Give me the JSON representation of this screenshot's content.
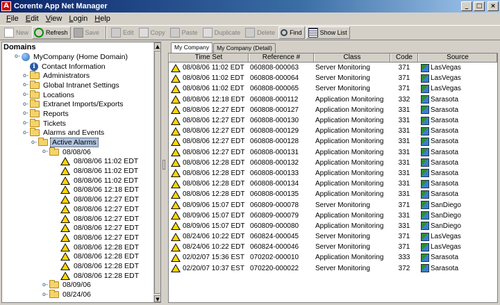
{
  "window": {
    "title": "Corente App Net Manager",
    "app_icon": "A"
  },
  "menu": [
    {
      "label": "File",
      "key": "F",
      "rest": "ile"
    },
    {
      "label": "Edit",
      "key": "E",
      "rest": "dit"
    },
    {
      "label": "View",
      "key": "V",
      "rest": "iew"
    },
    {
      "label": "Login",
      "key": "L",
      "rest": "ogin"
    },
    {
      "label": "Help",
      "key": "H",
      "rest": "elp"
    }
  ],
  "toolbar": {
    "new": "New",
    "refresh": "Refresh",
    "save": "Save",
    "edit": "Edit",
    "copy": "Copy",
    "paste": "Paste",
    "duplicate": "Duplicate",
    "delete": "Delete",
    "find": "Find",
    "show_list": "Show List"
  },
  "left": {
    "header": "Domains",
    "tree": [
      {
        "label": "MyCompany (Home Domain)",
        "icon": "globe",
        "level": 0,
        "exp": "minus"
      },
      {
        "label": "Contact Information",
        "icon": "info",
        "level": 1,
        "exp": "none"
      },
      {
        "label": "Administrators",
        "icon": "folder",
        "level": 1,
        "exp": "plus"
      },
      {
        "label": "Global Intranet Settings",
        "icon": "folder",
        "level": 1,
        "exp": "plus"
      },
      {
        "label": "Locations",
        "icon": "folder",
        "level": 1,
        "exp": "plus"
      },
      {
        "label": "Extranet Imports/Exports",
        "icon": "folder",
        "level": 1,
        "exp": "plus"
      },
      {
        "label": "Reports",
        "icon": "folder",
        "level": 1,
        "exp": "plus"
      },
      {
        "label": "Tickets",
        "icon": "folder",
        "level": 1,
        "exp": "plus"
      },
      {
        "label": "Alarms and Events",
        "icon": "folder",
        "level": 1,
        "exp": "minus"
      },
      {
        "label": "Active Alarms",
        "icon": "folder",
        "level": 2,
        "exp": "minus",
        "selected": true
      },
      {
        "label": "08/08/06",
        "icon": "folder",
        "level": 3,
        "exp": "minus"
      },
      {
        "label": "08/08/06 11:02 EDT",
        "icon": "warn",
        "level": 4,
        "exp": "none"
      },
      {
        "label": "08/08/06 11:02 EDT",
        "icon": "warn",
        "level": 4,
        "exp": "none"
      },
      {
        "label": "08/08/06 11:02 EDT",
        "icon": "warn",
        "level": 4,
        "exp": "none"
      },
      {
        "label": "08/08/06 12:18 EDT",
        "icon": "warn",
        "level": 4,
        "exp": "none"
      },
      {
        "label": "08/08/06 12:27 EDT",
        "icon": "warn",
        "level": 4,
        "exp": "none"
      },
      {
        "label": "08/08/06 12:27 EDT",
        "icon": "warn",
        "level": 4,
        "exp": "none"
      },
      {
        "label": "08/08/06 12:27 EDT",
        "icon": "warn",
        "level": 4,
        "exp": "none"
      },
      {
        "label": "08/08/06 12:27 EDT",
        "icon": "warn",
        "level": 4,
        "exp": "none"
      },
      {
        "label": "08/08/06 12:27 EDT",
        "icon": "warn",
        "level": 4,
        "exp": "none"
      },
      {
        "label": "08/08/06 12:28 EDT",
        "icon": "warn",
        "level": 4,
        "exp": "none"
      },
      {
        "label": "08/08/06 12:28 EDT",
        "icon": "warn",
        "level": 4,
        "exp": "none"
      },
      {
        "label": "08/08/06 12:28 EDT",
        "icon": "warn",
        "level": 4,
        "exp": "none"
      },
      {
        "label": "08/08/06 12:28 EDT",
        "icon": "warn",
        "level": 4,
        "exp": "none"
      },
      {
        "label": "08/09/06",
        "icon": "folder",
        "level": 3,
        "exp": "plus"
      },
      {
        "label": "08/24/06",
        "icon": "folder",
        "level": 3,
        "exp": "plus"
      }
    ]
  },
  "tabs": [
    "My Company",
    "My Company (Detail)"
  ],
  "table": {
    "columns": [
      "Time Set",
      "Reference #",
      "Class",
      "Code",
      "Source"
    ],
    "rows": [
      [
        "08/08/06 11:02 EDT",
        "060808-000063",
        "Server Monitoring",
        "371",
        "LasVegas"
      ],
      [
        "08/08/06 11:02 EDT",
        "060808-000064",
        "Server Monitoring",
        "371",
        "LasVegas"
      ],
      [
        "08/08/06 11:02 EDT",
        "060808-000065",
        "Server Monitoring",
        "371",
        "LasVegas"
      ],
      [
        "08/08/06 12:18 EDT",
        "060808-000112",
        "Application Monitoring",
        "332",
        "Sarasota"
      ],
      [
        "08/08/06 12:27 EDT",
        "060808-000127",
        "Application Monitoring",
        "331",
        "Sarasota"
      ],
      [
        "08/08/06 12:27 EDT",
        "060808-000130",
        "Application Monitoring",
        "331",
        "Sarasota"
      ],
      [
        "08/08/06 12:27 EDT",
        "060808-000129",
        "Application Monitoring",
        "331",
        "Sarasota"
      ],
      [
        "08/08/06 12:27 EDT",
        "060808-000128",
        "Application Monitoring",
        "331",
        "Sarasota"
      ],
      [
        "08/08/06 12:27 EDT",
        "060808-000131",
        "Application Monitoring",
        "331",
        "Sarasota"
      ],
      [
        "08/08/06 12:28 EDT",
        "060808-000132",
        "Application Monitoring",
        "331",
        "Sarasota"
      ],
      [
        "08/08/06 12:28 EDT",
        "060808-000133",
        "Application Monitoring",
        "331",
        "Sarasota"
      ],
      [
        "08/08/06 12:28 EDT",
        "060808-000134",
        "Application Monitoring",
        "331",
        "Sarasota"
      ],
      [
        "08/08/06 12:28 EDT",
        "060808-000135",
        "Application Monitoring",
        "331",
        "Sarasota"
      ],
      [
        "08/09/06 15:07 EDT",
        "060809-000078",
        "Server Monitoring",
        "371",
        "SanDiego"
      ],
      [
        "08/09/06 15:07 EDT",
        "060809-000079",
        "Application Monitoring",
        "331",
        "SanDiego"
      ],
      [
        "08/09/06 15:07 EDT",
        "060809-000080",
        "Application Monitoring",
        "331",
        "SanDiego"
      ],
      [
        "08/24/06 10:22 EDT",
        "060824-000045",
        "Server Monitoring",
        "371",
        "LasVegas"
      ],
      [
        "08/24/06 10:22 EDT",
        "060824-000046",
        "Server Monitoring",
        "371",
        "LasVegas"
      ],
      [
        "02/02/07 15:36 EST",
        "070202-000010",
        "Application Monitoring",
        "333",
        "Sarasota"
      ],
      [
        "02/20/07 10:37 EST",
        "070220-000022",
        "Server Monitoring",
        "372",
        "Sarasota"
      ]
    ]
  }
}
